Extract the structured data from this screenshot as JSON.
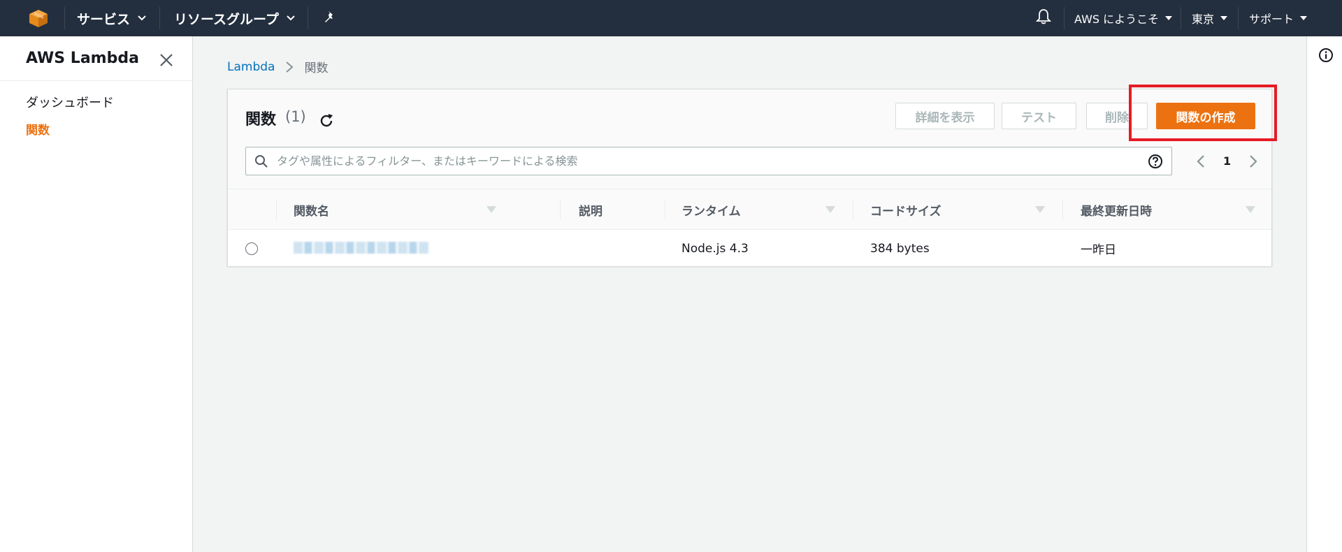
{
  "topnav": {
    "services_label": "サービス",
    "resource_groups_label": "リソースグループ",
    "welcome_label": "AWS にようこそ",
    "region_label": "東京",
    "support_label": "サポート",
    "bg_color": "#232f3e",
    "icons": [
      "aws-cube-logo-icon",
      "chevron-down-icon",
      "pin-icon",
      "bell-icon",
      "caret-down-icon"
    ]
  },
  "sidebar": {
    "title": "AWS Lambda",
    "items": [
      {
        "label": "ダッシュボード",
        "active": false
      },
      {
        "label": "関数",
        "active": true
      }
    ],
    "active_color": "#ec7211"
  },
  "breadcrumb": {
    "root": "Lambda",
    "current": "関数"
  },
  "functions_panel": {
    "title": "関数",
    "count": "(1)",
    "buttons": {
      "details": "詳細を表示",
      "test": "テスト",
      "delete": "削除",
      "create": "関数の作成"
    },
    "primary_color": "#ec7211",
    "highlight_color": "#e51b24",
    "search": {
      "placeholder": "タグや属性によるフィルター、またはキーワードによる検索",
      "value": ""
    },
    "pager": {
      "page": "1"
    },
    "columns": [
      "関数名",
      "説明",
      "ランタイム",
      "コードサイズ",
      "最終更新日時"
    ],
    "rows": [
      {
        "name": "",
        "description": "",
        "runtime": "Node.js 4.3",
        "code_size": "384 bytes",
        "last_modified": "一昨日"
      }
    ]
  }
}
